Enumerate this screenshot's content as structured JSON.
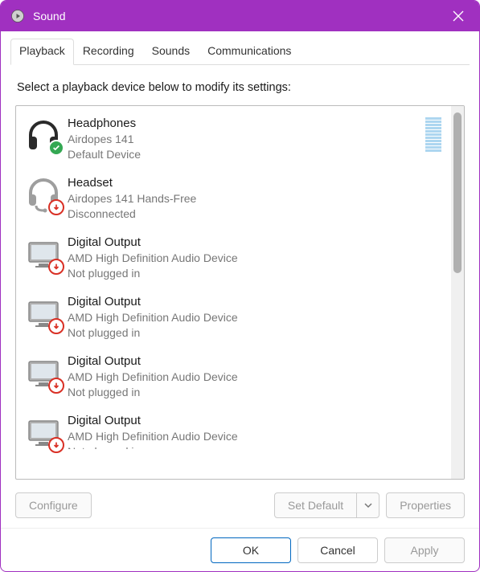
{
  "window": {
    "title": "Sound"
  },
  "tabs": [
    "Playback",
    "Recording",
    "Sounds",
    "Communications"
  ],
  "active_tab": 0,
  "instruction": "Select a playback device below to modify its settings:",
  "devices": [
    {
      "icon": "headphones",
      "badge": "check",
      "name": "Headphones",
      "sub": "Airdopes 141",
      "status": "Default Device",
      "level": true
    },
    {
      "icon": "headset",
      "badge": "down",
      "name": "Headset",
      "sub": "Airdopes 141 Hands-Free",
      "status": "Disconnected",
      "level": false
    },
    {
      "icon": "monitor",
      "badge": "down",
      "name": "Digital Output",
      "sub": "AMD High Definition Audio Device",
      "status": "Not plugged in",
      "level": false
    },
    {
      "icon": "monitor",
      "badge": "down",
      "name": "Digital Output",
      "sub": "AMD High Definition Audio Device",
      "status": "Not plugged in",
      "level": false
    },
    {
      "icon": "monitor",
      "badge": "down",
      "name": "Digital Output",
      "sub": "AMD High Definition Audio Device",
      "status": "Not plugged in",
      "level": false
    },
    {
      "icon": "monitor",
      "badge": "down",
      "name": "Digital Output",
      "sub": "AMD High Definition Audio Device",
      "status": "Not plugged in",
      "level": false
    }
  ],
  "buttons": {
    "configure": "Configure",
    "set_default": "Set Default",
    "properties": "Properties",
    "ok": "OK",
    "cancel": "Cancel",
    "apply": "Apply"
  }
}
